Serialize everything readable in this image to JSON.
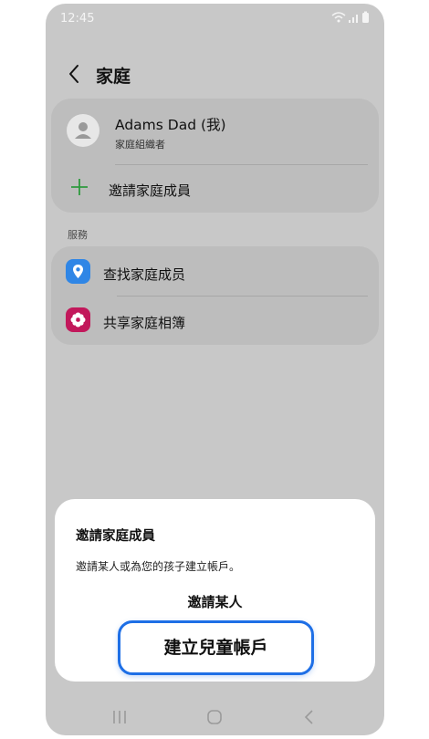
{
  "status_bar": {
    "time": "12:45"
  },
  "header": {
    "title": "家庭"
  },
  "family": {
    "member_name": "Adams Dad (我)",
    "member_role": "家庭組織者",
    "invite_label": "邀請家庭成員"
  },
  "services": {
    "section_label": "服務",
    "items": [
      {
        "label": "查找家庭成员",
        "icon": "location-pin-icon",
        "color": "#2f86e6"
      },
      {
        "label": "共享家庭相簿",
        "icon": "flower-icon",
        "color": "#c2185b"
      }
    ]
  },
  "sheet": {
    "title": "邀請家庭成員",
    "description": "邀請某人或為您的孩子建立帳戶。",
    "action_invite": "邀請某人",
    "action_child": "建立兒童帳戶"
  },
  "colors": {
    "accent": "#1e6fe6",
    "plus": "#2e9a3e"
  }
}
